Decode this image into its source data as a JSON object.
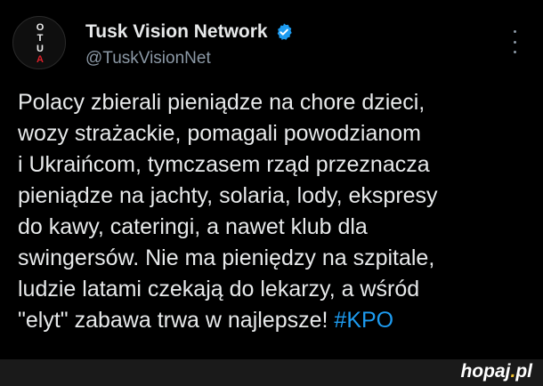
{
  "profile": {
    "display_name": "Tusk Vision Network",
    "handle": "@TuskVisionNet",
    "avatar_letters": [
      "O",
      "T",
      "U",
      "A"
    ],
    "verified_color": "#1d9bf0"
  },
  "post": {
    "lines": [
      "Polacy zbierali pieniądze na chore dzieci,",
      "wozy strażackie, pomagali powodzianom",
      "i Ukraińcom, tymczasem rząd przeznacza",
      "pieniądze na jachty, solaria, lody, ekspresy",
      "do kawy, cateringi, a nawet klub dla",
      "swingersów. Nie ma pieniędzy na szpitale,",
      "ludzie latami czekają do lekarzy, a wśród"
    ],
    "last_line": "\"elyt\" zabawa trwa w najlepsze!",
    "hashtag": "#KPO"
  },
  "watermark": {
    "brand": "hopaj",
    "dot": ".",
    "tld": "pl"
  },
  "colors": {
    "background": "#000000",
    "text": "#e7e9ea",
    "muted": "#8b98a5",
    "link": "#1d9bf0"
  }
}
